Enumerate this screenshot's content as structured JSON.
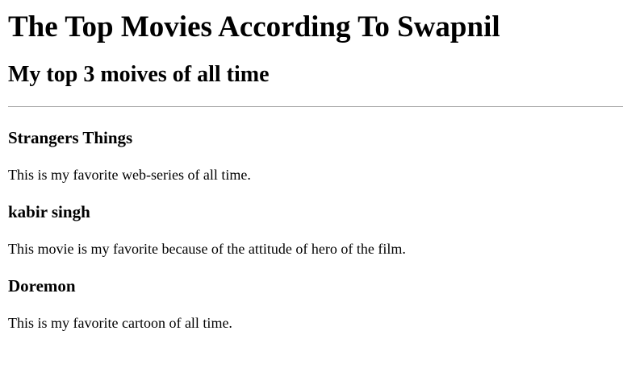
{
  "heading": "The Top Movies According To Swapnil",
  "subheading": "My top 3 moives of all time",
  "movies": [
    {
      "title": "Strangers Things",
      "description": "This is my favorite web-series of all time."
    },
    {
      "title": "kabir singh",
      "description": "This movie is my favorite because of the attitude of hero of the film."
    },
    {
      "title": "Doremon",
      "description": "This is my favorite cartoon of all time."
    }
  ]
}
